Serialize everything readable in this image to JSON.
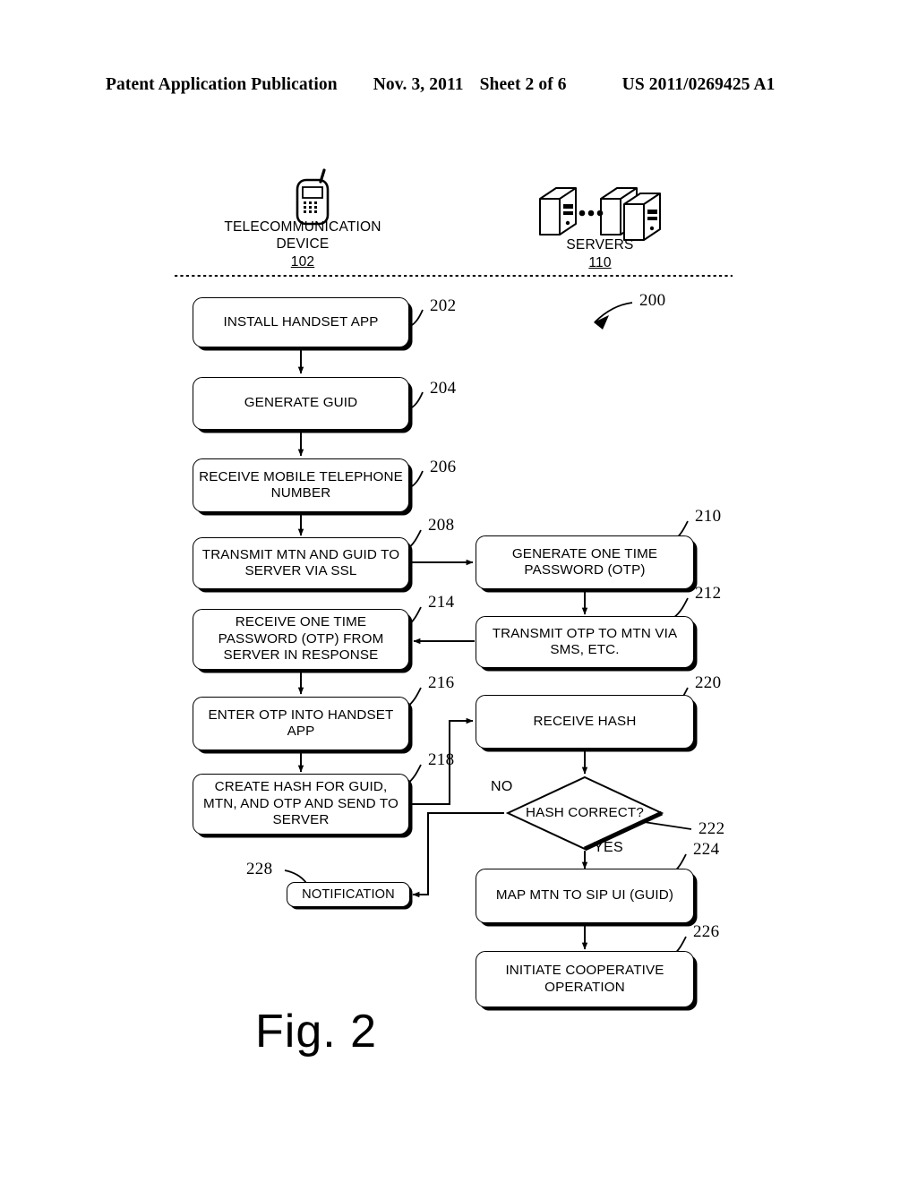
{
  "header": {
    "publication": "Patent Application Publication",
    "date": "Nov. 3, 2011",
    "sheet": "Sheet 2 of 6",
    "patent_number": "US 2011/0269425 A1"
  },
  "figure": {
    "caption": "Fig. 2",
    "diagram_ref": "200",
    "lanes": [
      {
        "name": "telecommunication-device",
        "label_line1": "TELECOMMUNICATION",
        "label_line2": "DEVICE",
        "ref": "102",
        "icon": "mobile-phone-icon"
      },
      {
        "name": "servers",
        "label_line1": "SERVERS",
        "label_line2": "",
        "ref": "110",
        "icon": "servers-icon"
      }
    ],
    "nodes": [
      {
        "id": "202",
        "lane": "device",
        "shape": "process",
        "text": "INSTALL HANDSET APP"
      },
      {
        "id": "204",
        "lane": "device",
        "shape": "process",
        "text": "GENERATE GUID"
      },
      {
        "id": "206",
        "lane": "device",
        "shape": "process",
        "text": "RECEIVE MOBILE TELEPHONE NUMBER"
      },
      {
        "id": "208",
        "lane": "device",
        "shape": "process",
        "text": "TRANSMIT MTN AND GUID TO SERVER VIA SSL"
      },
      {
        "id": "210",
        "lane": "servers",
        "shape": "process",
        "text": "GENERATE ONE TIME PASSWORD (OTP)"
      },
      {
        "id": "212",
        "lane": "servers",
        "shape": "process",
        "text": "TRANSMIT OTP TO MTN VIA SMS, ETC."
      },
      {
        "id": "214",
        "lane": "device",
        "shape": "process",
        "text": "RECEIVE ONE TIME PASSWORD (OTP) FROM SERVER IN RESPONSE"
      },
      {
        "id": "216",
        "lane": "device",
        "shape": "process",
        "text": "ENTER OTP INTO HANDSET APP"
      },
      {
        "id": "218",
        "lane": "device",
        "shape": "process",
        "text": "CREATE HASH FOR GUID, MTN, AND OTP AND SEND TO SERVER"
      },
      {
        "id": "220",
        "lane": "servers",
        "shape": "process",
        "text": "RECEIVE HASH"
      },
      {
        "id": "222",
        "lane": "servers",
        "shape": "decision",
        "text": "HASH CORRECT?"
      },
      {
        "id": "224",
        "lane": "servers",
        "shape": "process",
        "text": "MAP MTN TO SIP UI (GUID)"
      },
      {
        "id": "226",
        "lane": "servers",
        "shape": "process",
        "text": "INITIATE COOPERATIVE OPERATION"
      },
      {
        "id": "228",
        "lane": "device",
        "shape": "process",
        "text": "NOTIFICATION"
      }
    ],
    "branch_labels": {
      "no": "NO",
      "yes": "YES"
    }
  }
}
